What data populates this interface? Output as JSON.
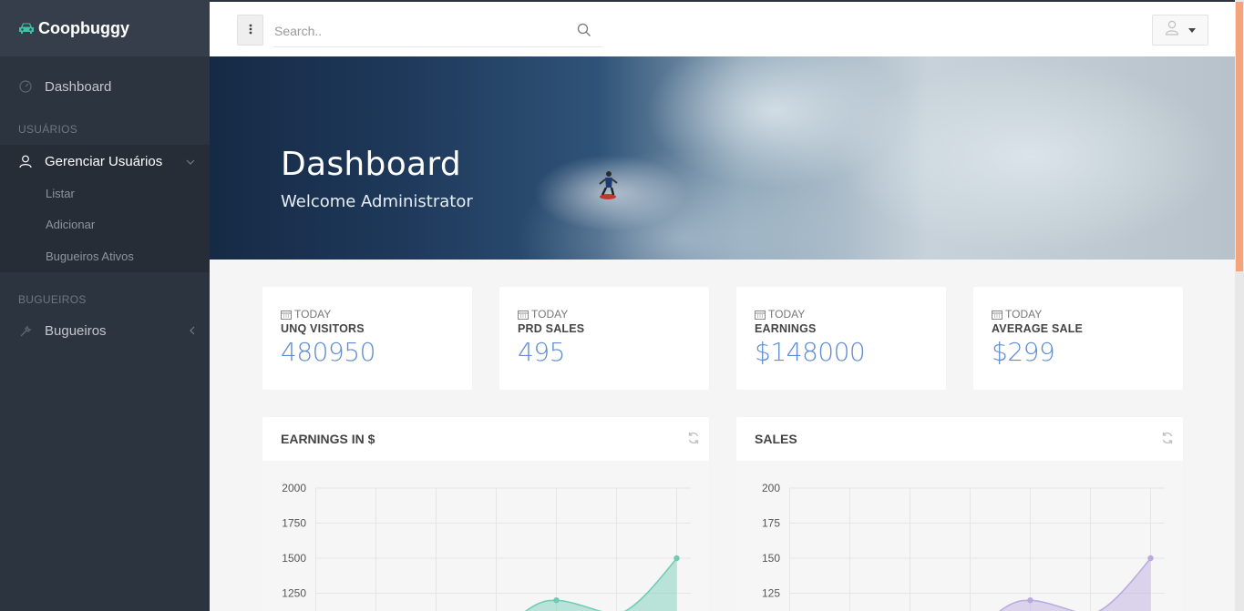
{
  "brand": {
    "name": "Coopbuggy"
  },
  "sidebar": {
    "dashboard": "Dashboard",
    "section_usuarios": "USUÁRIOS",
    "gerenciar": "Gerenciar Usuários",
    "submenu": [
      "Listar",
      "Adicionar",
      "Bugueiros Ativos"
    ],
    "section_bugueiros": "BUGUEIROS",
    "bugueiros": "Bugueiros"
  },
  "topbar": {
    "search_placeholder": "Search.."
  },
  "hero": {
    "title": "Dashboard",
    "subtitle": "Welcome Administrator"
  },
  "stats": [
    {
      "period": "TODAY",
      "label": "UNQ VISITORS",
      "value": "480950"
    },
    {
      "period": "TODAY",
      "label": "PRD SALES",
      "value": "495"
    },
    {
      "period": "TODAY",
      "label": "EARNINGS",
      "value": "$148000"
    },
    {
      "period": "TODAY",
      "label": "AVERAGE SALE",
      "value": "$299"
    }
  ],
  "colors": {
    "accent": "#5f8dd3",
    "earnings_series": "#6fcab3",
    "sales_series": "#b9a9dd",
    "sidebar": "#2c343f"
  },
  "chart_data": [
    {
      "type": "area",
      "title": "EARNINGS IN $",
      "ylim": [
        1000,
        2000
      ],
      "y_ticks": [
        "2000",
        "1750",
        "1500",
        "1250"
      ],
      "series": [
        {
          "points": [
            [
              4,
              1200
            ],
            [
              6,
              1500
            ]
          ]
        }
      ],
      "grid": true
    },
    {
      "type": "area",
      "title": "SALES",
      "ylim": [
        100,
        200
      ],
      "y_ticks": [
        "200",
        "175",
        "150",
        "125"
      ],
      "series": [
        {
          "points": [
            [
              4,
              120
            ],
            [
              6,
              150
            ]
          ]
        }
      ],
      "grid": true
    }
  ]
}
